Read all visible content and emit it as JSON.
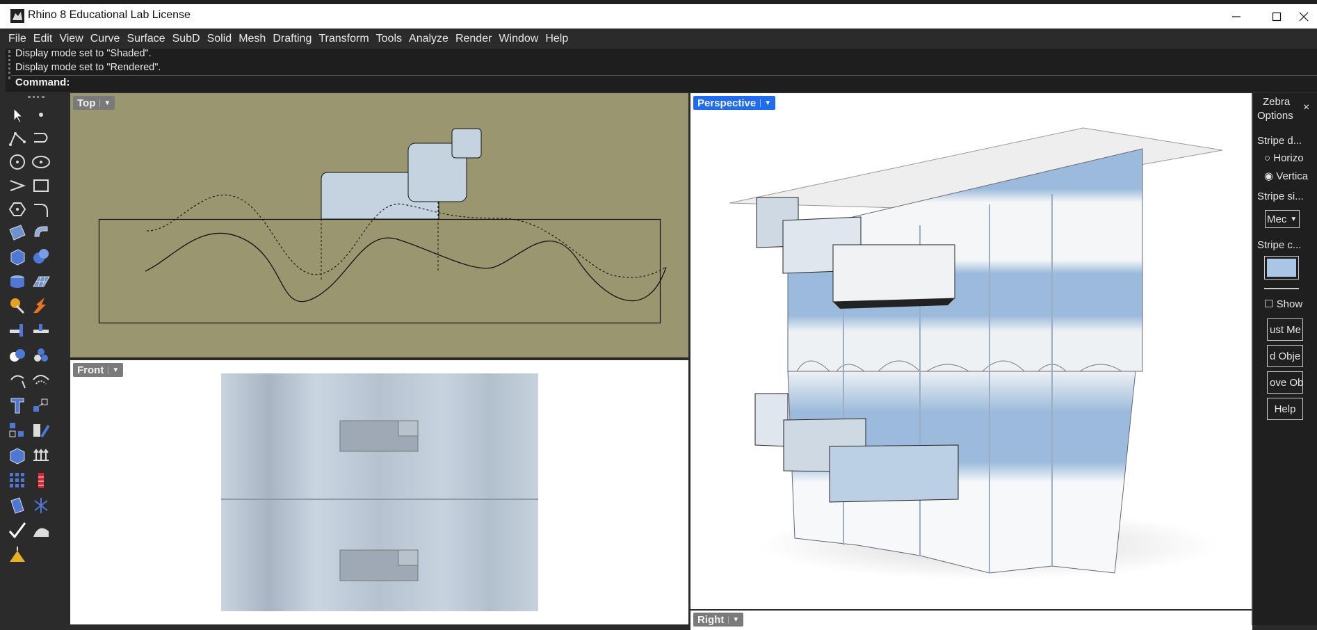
{
  "window": {
    "title": "Rhino 8 Educational Lab License",
    "minimize_icon": "minimize-icon",
    "maximize_icon": "maximize-icon",
    "close_icon": "close-icon"
  },
  "menu": [
    "File",
    "Edit",
    "View",
    "Curve",
    "Surface",
    "SubD",
    "Solid",
    "Mesh",
    "Drafting",
    "Transform",
    "Tools",
    "Analyze",
    "Render",
    "Window",
    "Help"
  ],
  "command": {
    "history": [
      "Display mode set to \"Shaded\".",
      "Display mode set to \"Rendered\"."
    ],
    "prompt": "Command:"
  },
  "viewports": {
    "top": {
      "label": "Top",
      "background": "#9a9670"
    },
    "front": {
      "label": "Front"
    },
    "perspective": {
      "label": "Perspective",
      "accent": "#1e6cf2"
    },
    "right": {
      "label": "Right"
    }
  },
  "zebra": {
    "title_line1": "Zebra",
    "title_line2": "Options",
    "stripe_direction": "Stripe d...",
    "horizontal": "Horizo",
    "vertical": "Vertica",
    "stripe_size": "Stripe si...",
    "size_value": "Mec",
    "stripe_color": "Stripe c...",
    "stripe_color_value": "#a9c6e6",
    "show": "Show",
    "adjust_mesh": "ust Me",
    "add_objects": "d Obje",
    "remove_objects": "ove Ob",
    "help": "Help"
  },
  "colors": {
    "zebra_blue": "#9cbbdc",
    "top_bg": "#9a9670"
  }
}
